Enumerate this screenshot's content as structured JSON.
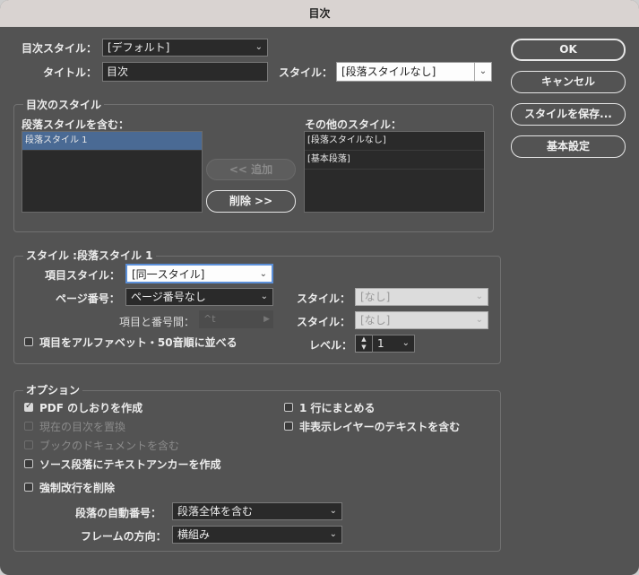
{
  "window": {
    "title": "目次"
  },
  "toc_style": {
    "label": "目次スタイル：",
    "value": "[デフォルト]"
  },
  "title_row": {
    "label": "タイトル：",
    "value": "目次",
    "style_label": "スタイル：",
    "style_value": "[段落スタイルなし]"
  },
  "buttons": {
    "ok": "OK",
    "cancel": "キャンセル",
    "save_style": "スタイルを保存...",
    "basic_settings": "基本設定"
  },
  "styles_section": {
    "title": "目次のスタイル",
    "include_label": "段落スタイルを含む：",
    "include_items": [
      "段落スタイル 1"
    ],
    "other_label": "その他のスタイル：",
    "other_items": [
      "[段落スタイルなし]",
      "[基本段落]"
    ],
    "add_button": "<< 追加",
    "remove_button": "削除 >>"
  },
  "style_section": {
    "title": "スタイル :段落スタイル 1",
    "entry_style_label": "項目スタイル：",
    "entry_style_value": "[同一スタイル]",
    "page_number_label": "ページ番号：",
    "page_number_value": "ページ番号なし",
    "page_style_label": "スタイル：",
    "page_style_value": "[なし]",
    "between_label": "項目と番号間：",
    "between_value": "^t",
    "between_style_label": "スタイル：",
    "between_style_value": "[なし]",
    "sort_label": "項目をアルファベット・50音順に並べる",
    "level_label": "レベル：",
    "level_value": "1"
  },
  "options": {
    "title": "オプション",
    "create_pdf_bookmarks": {
      "label": "PDF のしおりを作成",
      "checked": true
    },
    "replace_existing": {
      "label": "現在の目次を置換",
      "checked": false
    },
    "include_book": {
      "label": "ブックのドキュメントを含む",
      "checked": false
    },
    "make_anchor": {
      "label": "ソース段落にテキストアンカーを作成",
      "checked": false
    },
    "remove_forced_breaks": {
      "label": "強制改行を削除",
      "checked": false
    },
    "run_in": {
      "label": "1 行にまとめる",
      "checked": false
    },
    "hidden_layers": {
      "label": "非表示レイヤーのテキストを含む",
      "checked": false
    },
    "numbered_paragraphs_label": "段落の自動番号：",
    "numbered_paragraphs_value": "段落全体を含む",
    "frame_direction_label": "フレームの方向：",
    "frame_direction_value": "横組み"
  }
}
